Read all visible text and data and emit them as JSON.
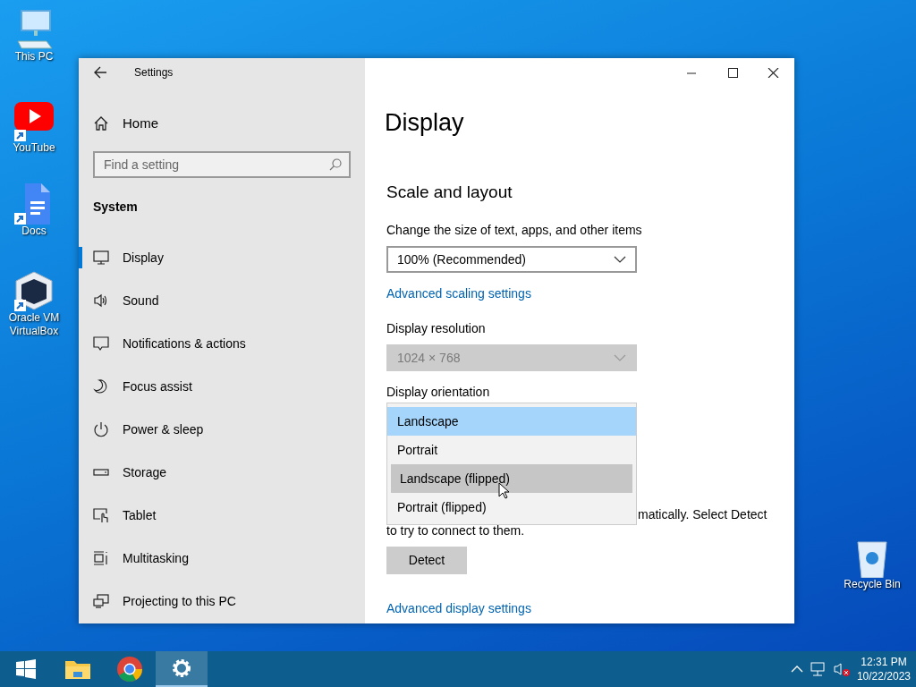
{
  "desktop_icons": [
    {
      "label": "This PC",
      "kind": "computer",
      "shortcut": false
    },
    {
      "label": "YouTube",
      "kind": "video",
      "shortcut": true
    },
    {
      "label": "Docs",
      "kind": "document",
      "shortcut": true
    },
    {
      "label": "Oracle VM VirtualBox",
      "kind": "cube",
      "shortcut": true
    },
    {
      "label": "Recycle Bin",
      "kind": "bin",
      "shortcut": false
    }
  ],
  "window": {
    "title": "Settings"
  },
  "sidebar": {
    "home": "Home",
    "search": {
      "placeholder": "Find a setting"
    },
    "section": "System",
    "items": [
      {
        "label": "Display",
        "selected": true
      },
      {
        "label": "Sound",
        "selected": false
      },
      {
        "label": "Notifications & actions",
        "selected": false
      },
      {
        "label": "Focus assist",
        "selected": false
      },
      {
        "label": "Power & sleep",
        "selected": false
      },
      {
        "label": "Storage",
        "selected": false
      },
      {
        "label": "Tablet",
        "selected": false
      },
      {
        "label": "Multitasking",
        "selected": false
      },
      {
        "label": "Projecting to this PC",
        "selected": false
      }
    ]
  },
  "content": {
    "title": "Display",
    "section": "Scale and layout",
    "scale": {
      "label": "Change the size of text, apps, and other items",
      "value": "100% (Recommended)",
      "disabled": false
    },
    "scale_link": "Advanced scaling settings",
    "resolution": {
      "label": "Display resolution",
      "value": "1024 × 768",
      "disabled": true
    },
    "orientation": {
      "label": "Display orientation",
      "options": [
        {
          "label": "Landscape",
          "selected": true,
          "hovered": false
        },
        {
          "label": "Portrait",
          "selected": false,
          "hovered": false
        },
        {
          "label": "Landscape (flipped)",
          "selected": false,
          "hovered": true
        },
        {
          "label": "Portrait (flipped)",
          "selected": false,
          "hovered": false
        }
      ]
    },
    "detect_text": [
      "matically. Select Detect",
      "to try to connect to them."
    ],
    "detect_button": "Detect",
    "advanced_link": "Advanced display settings"
  },
  "taskbar": {
    "apps": [
      {
        "kind": "start",
        "selected": false
      },
      {
        "kind": "folder",
        "selected": false
      },
      {
        "kind": "browser",
        "selected": false
      },
      {
        "kind": "gear",
        "selected": true
      }
    ],
    "time": "12:31 PM",
    "date": "10/22/2023"
  }
}
